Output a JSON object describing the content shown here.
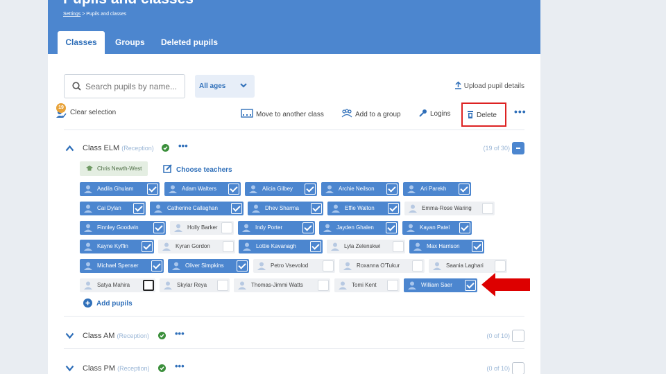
{
  "header": {
    "title": "Pupils and classes",
    "breadcrumb_link": "Settings",
    "breadcrumb_separator": " > ",
    "breadcrumb_current": "Pupils and classes",
    "tabs": [
      {
        "label": "Classes",
        "active": true
      },
      {
        "label": "Groups",
        "active": false
      },
      {
        "label": "Deleted pupils",
        "active": false
      }
    ]
  },
  "search": {
    "placeholder": "Search pupils by name..."
  },
  "age_filter": {
    "label": "All ages"
  },
  "upload_label": "Upload pupil details",
  "toolbar": {
    "selection_count": "19",
    "clear_label": "Clear selection",
    "move_label": "Move to another class",
    "group_label": "Add to a group",
    "logins_label": "Logins",
    "delete_label": "Delete",
    "more_label": "•••"
  },
  "classes": [
    {
      "name": "Class ELM",
      "age": "(Reception)",
      "count": "(19 of 30)",
      "expanded": true,
      "teacher": "Chris Newth-West",
      "choose_teachers": "Choose teachers",
      "add_pupils": "Add pupils",
      "pupils": [
        {
          "name": "Aadila Ghulam",
          "selected": true
        },
        {
          "name": "Adam Walters",
          "selected": true
        },
        {
          "name": "Alicia Gilbey",
          "selected": true
        },
        {
          "name": "Archie Neilson",
          "selected": true
        },
        {
          "name": "Ari Parekh",
          "selected": true
        },
        {
          "name": "Cai Dylan",
          "selected": true
        },
        {
          "name": "Catherine Callaghan",
          "selected": true
        },
        {
          "name": "Dhev Sharma",
          "selected": true
        },
        {
          "name": "Effie Walton",
          "selected": true
        },
        {
          "name": "Emma-Rose Waring",
          "selected": false
        },
        {
          "name": "Finnley Goodwin",
          "selected": true
        },
        {
          "name": "Holly Barker",
          "selected": false
        },
        {
          "name": "Indy Porter",
          "selected": true
        },
        {
          "name": "Jayden Ghalen",
          "selected": true
        },
        {
          "name": "Kayan Patel",
          "selected": true
        },
        {
          "name": "Kayne Kyffin",
          "selected": true
        },
        {
          "name": "Kyran Gordon",
          "selected": false
        },
        {
          "name": "Lottie Kavanagh",
          "selected": true
        },
        {
          "name": "Lyla Zelenskwi",
          "selected": false
        },
        {
          "name": "Max Harrison",
          "selected": true
        },
        {
          "name": "Michael Spenser",
          "selected": true
        },
        {
          "name": "Oliver Simpkins",
          "selected": true
        },
        {
          "name": "Petro Vsevolod",
          "selected": false
        },
        {
          "name": "Roxanna O'Tukur",
          "selected": false
        },
        {
          "name": "Saania Laghari",
          "selected": false
        },
        {
          "name": "Satya Mahira",
          "selected": false
        },
        {
          "name": "Skylar Reya",
          "selected": false
        },
        {
          "name": "Thomas-Jimmi Watts",
          "selected": false
        },
        {
          "name": "Tomi Kent",
          "selected": false
        },
        {
          "name": "William Saer",
          "selected": true
        }
      ]
    },
    {
      "name": "Class AM",
      "age": "(Reception)",
      "count": "(0 of 10)",
      "expanded": false
    },
    {
      "name": "Class PM",
      "age": "(Reception)",
      "count": "(0 of 10)",
      "expanded": false
    }
  ],
  "colors": {
    "brand_blue": "#4c86cf",
    "highlight_red": "#dd2222",
    "status_green": "#3b8f3b",
    "badge_orange": "#e8a33a"
  }
}
